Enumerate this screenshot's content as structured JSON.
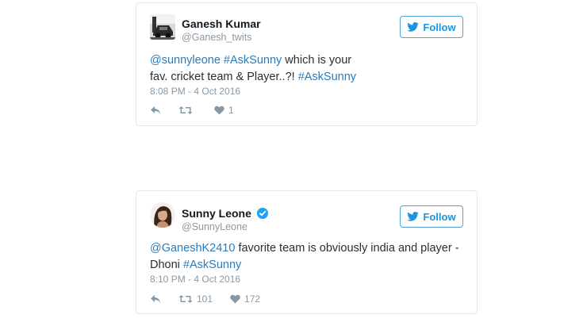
{
  "tweets": [
    {
      "author_name": "Ganesh Kumar",
      "author_handle": "@Ganesh_twits",
      "verified": false,
      "follow_label": "Follow",
      "text_parts": [
        {
          "text": "@sunnyleone",
          "link": true
        },
        {
          "text": " ",
          "link": false
        },
        {
          "text": "#AskSunny",
          "link": true
        },
        {
          "text": " which is your fav. cricket team & Player..?! ",
          "link": false
        },
        {
          "text": "#AskSunny",
          "link": true
        }
      ],
      "timestamp": "8:08 PM - 4 Oct 2016",
      "retweets": "",
      "likes": "1",
      "avatar_icon": "car-photo-avatar"
    },
    {
      "author_name": "Sunny Leone",
      "author_handle": "@SunnyLeone",
      "verified": true,
      "follow_label": "Follow",
      "text_parts": [
        {
          "text": "@GaneshK2410",
          "link": true
        },
        {
          "text": " favorite team is obviously india and player - Dhoni ",
          "link": false
        },
        {
          "text": "#AskSunny",
          "link": true
        }
      ],
      "timestamp": "8:10 PM - 4 Oct 2016",
      "retweets": "101",
      "likes": "172",
      "avatar_icon": "portrait-photo-avatar"
    }
  ],
  "colors": {
    "link": "#2b7bb9",
    "follow_border": "#4fa3df",
    "muted": "#8899a6",
    "verified": "#1da1f2"
  }
}
